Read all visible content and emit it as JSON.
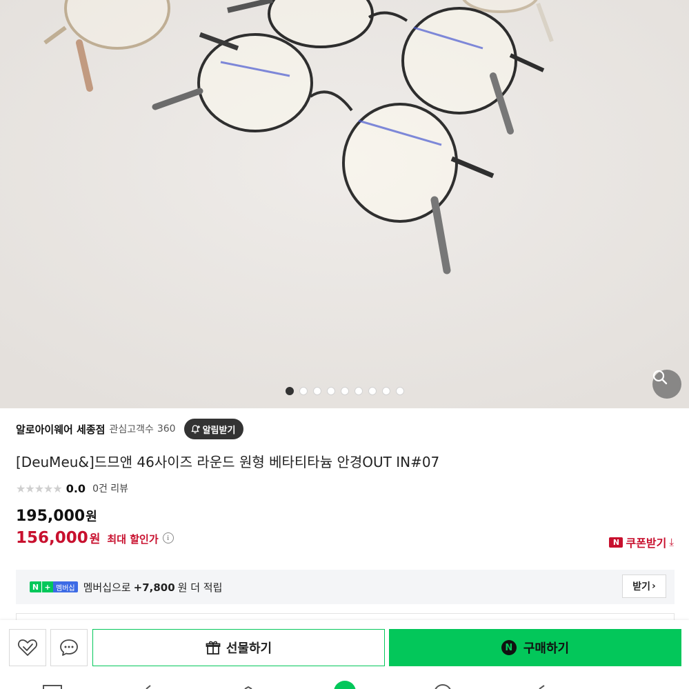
{
  "hero": {
    "image_desc": "photo",
    "dots_total": 9,
    "active_dot": 0,
    "zoom_icon": "search-icon"
  },
  "store": {
    "name": "알로아이웨어 세종점",
    "fans_label": "관심고객수",
    "fans_count": "360",
    "alarm_label": "알림받기",
    "alarm_icon": "bell-plus-icon"
  },
  "product": {
    "title": "[DeuMeu&]드므앤 46사이즈 라운드 원형 베타티타늄 안경OUT IN#07"
  },
  "rating": {
    "score": "0.0",
    "reviews_label": "0건 리뷰",
    "stars_filled": 0,
    "stars_total": 5
  },
  "price": {
    "original": "195,000",
    "original_unit": "원",
    "sale": "156,000",
    "sale_unit": "원",
    "max_discount_label": "최대 할인가",
    "info_glyph": "i"
  },
  "coupon": {
    "badge": "N",
    "label": "쿠폰받기",
    "download_glyph": "⤓"
  },
  "membership": {
    "badge_n": "N",
    "badge_plus": "+",
    "badge_text": "멤버십",
    "text_prefix": "멤버십으로",
    "points": "+7,800",
    "text_suffix": "원 더 적립",
    "receive_label": "받기",
    "receive_chevron": "›"
  },
  "actions": {
    "wish_icon": "heart-check-icon",
    "talk_icon": "chat-bubble-icon",
    "gift_label": "선물하기",
    "gift_icon": "gift-icon",
    "buy_label": "구매하기",
    "buy_badge": "N"
  },
  "colors": {
    "sale_red": "#c8102e",
    "naver_green": "#03c75a",
    "hero_bg": "#ebe7e3"
  }
}
